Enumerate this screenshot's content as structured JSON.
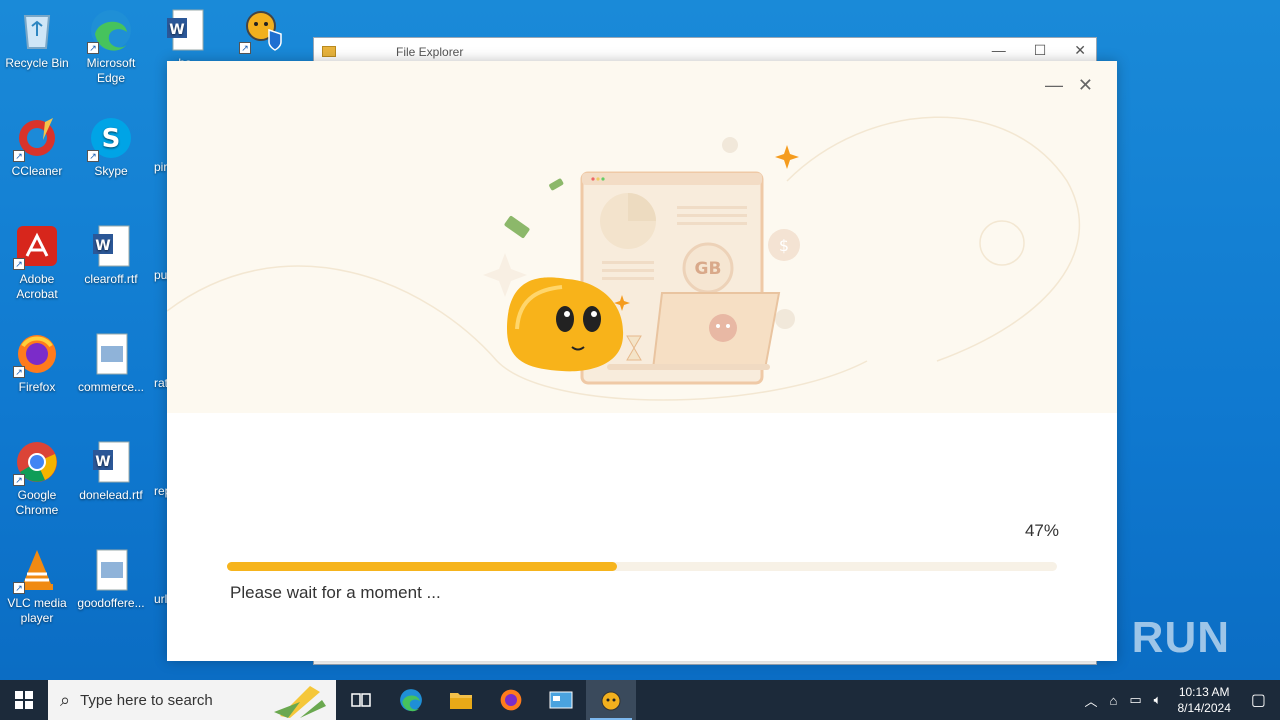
{
  "desktop": {
    "icons_col1": [
      {
        "label": "Recycle Bin",
        "icon": "recycle-bin-icon"
      },
      {
        "label": "CCleaner",
        "icon": "ccleaner-icon"
      },
      {
        "label": "Adobe Acrobat",
        "icon": "acrobat-icon"
      },
      {
        "label": "Firefox",
        "icon": "firefox-icon"
      },
      {
        "label": "Google Chrome",
        "icon": "chrome-icon"
      },
      {
        "label": "VLC media player",
        "icon": "vlc-icon"
      }
    ],
    "icons_col2": [
      {
        "label": "Microsoft Edge",
        "icon": "edge-icon"
      },
      {
        "label": "Skype",
        "icon": "skype-icon"
      },
      {
        "label": "clearoff.rtf",
        "icon": "word-doc-icon"
      },
      {
        "label": "commerce...",
        "icon": "image-file-icon"
      },
      {
        "label": "donelead.rtf",
        "icon": "word-doc-icon"
      },
      {
        "label": "goodoffere...",
        "icon": "image-file-icon"
      }
    ],
    "icons_col3": [
      {
        "label": "ha",
        "icon": "word-doc-icon"
      },
      {
        "label": "pir",
        "icon": "file-icon"
      },
      {
        "label": "pu",
        "icon": "file-icon"
      },
      {
        "label": "rat",
        "icon": "file-icon"
      },
      {
        "label": "rep",
        "icon": "file-icon"
      },
      {
        "label": "url",
        "icon": "file-icon"
      }
    ]
  },
  "explorer": {
    "title": "File Explorer"
  },
  "installer": {
    "progress_percent": 47,
    "progress_label": "47%",
    "status": "Please wait for a moment ...",
    "badge_text": "GB",
    "colors": {
      "accent": "#f6b41d",
      "hero_bg": "#fdf9f0"
    }
  },
  "taskbar": {
    "search_placeholder": "Type here to search",
    "time": "10:13 AM",
    "date": "8/14/2024"
  },
  "watermark": "ANY RUN"
}
